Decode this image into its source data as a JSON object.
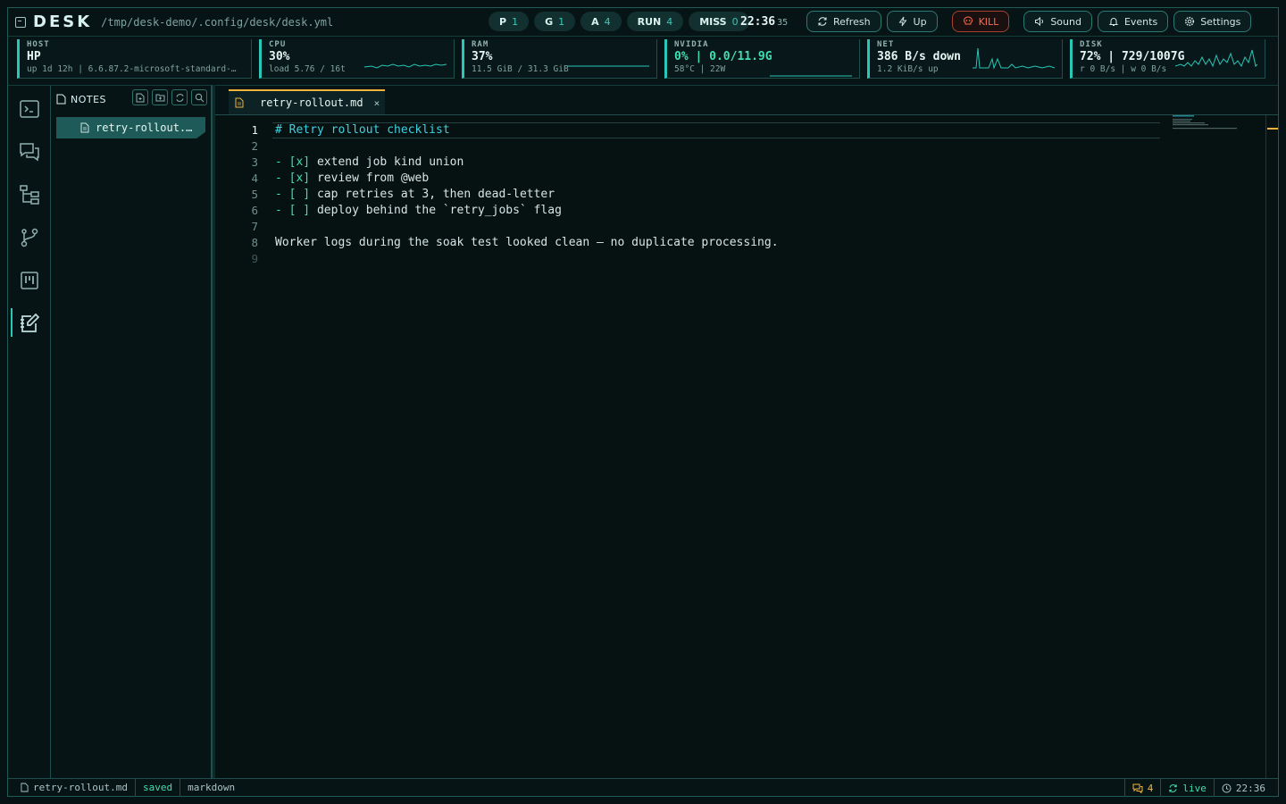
{
  "app": {
    "brand": "DESK",
    "config_path": "/tmp/desk-demo/.config/desk/desk.yml"
  },
  "pills": [
    {
      "label": "P",
      "value": "1"
    },
    {
      "label": "G",
      "value": "1"
    },
    {
      "label": "A",
      "value": "4"
    },
    {
      "label": "RUN",
      "value": "4"
    },
    {
      "label": "MISS",
      "value": "0"
    }
  ],
  "clock": {
    "time": "22:36",
    "seconds": "35"
  },
  "toolbar": {
    "refresh": "Refresh",
    "up": "Up",
    "kill": "KILL",
    "sound": "Sound",
    "events": "Events",
    "settings": "Settings"
  },
  "stats": {
    "host": {
      "label": "HOST",
      "value": "HP",
      "sub": "up 1d 12h | 6.6.87.2-microsoft-standard-…"
    },
    "cpu": {
      "label": "CPU",
      "value": "30%",
      "sub": "load 5.76 / 16t"
    },
    "ram": {
      "label": "RAM",
      "value": "37%",
      "sub": "11.5 GiB / 31.3 GiB"
    },
    "gpu": {
      "label": "NVIDIA",
      "value": "0% | 0.0/11.9G",
      "sub": "58°C | 22W"
    },
    "net": {
      "label": "NET",
      "value": "386 B/s down",
      "sub": "1.2 KiB/s up"
    },
    "disk": {
      "label": "DISK",
      "value": "72% | 729/1007G",
      "sub": "r 0 B/s | w 0 B/s"
    }
  },
  "notes_panel": {
    "title": "NOTES",
    "files": [
      "retry-rollout.…"
    ]
  },
  "editor": {
    "tab_title": "retry-rollout.md",
    "tab_close": "×",
    "current_line": "1",
    "lines": [
      {
        "n": "1",
        "text": "# Retry rollout checklist"
      },
      {
        "n": "2",
        "text": ""
      },
      {
        "n": "3",
        "bullet": "- [x]",
        "text": " extend job kind union"
      },
      {
        "n": "4",
        "bullet": "- [x]",
        "text": " review from @web"
      },
      {
        "n": "5",
        "bullet": "- [ ]",
        "text": " cap retries at 3, then dead-letter"
      },
      {
        "n": "6",
        "bullet": "- [ ]",
        "text": " deploy behind the `retry_jobs` flag"
      },
      {
        "n": "7",
        "text": ""
      },
      {
        "n": "8",
        "text": "Worker logs during the soak test looked clean — no duplicate processing."
      },
      {
        "n": "9",
        "text": ""
      }
    ]
  },
  "statusbar": {
    "file": "retry-rollout.md",
    "state": "saved",
    "mode": "markdown",
    "comments": "4",
    "live": "live",
    "time": "22:36"
  },
  "colors": {
    "accent": "#28c7b7",
    "active_tab": "#f2b33d",
    "kill": "#ff6a4d",
    "green": "#3fe0b0"
  }
}
